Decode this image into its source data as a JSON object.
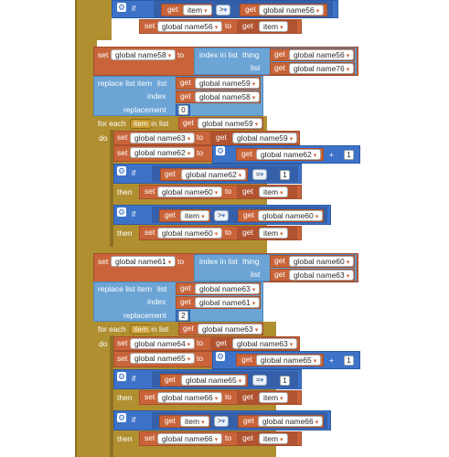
{
  "kw": {
    "if": "if",
    "then": "then",
    "set": "set",
    "to": "to",
    "get": "get",
    "index_in_list": "index in list",
    "thing": "thing",
    "list": "list",
    "replace_list_item": "replace list item",
    "index": "index",
    "replacement": "replacement",
    "for_each": "for each",
    "in_list": "in list",
    "do": "do",
    "item": "item",
    "plus": "+"
  },
  "ops": {
    "gt": ">",
    "eq": "="
  },
  "vars": {
    "n56": "global name56",
    "n58": "global name58",
    "n59": "global name59",
    "n60": "global name60",
    "n61": "global name61",
    "n62": "global name62",
    "n63": "global name63",
    "n64": "global name64",
    "n65": "global name65",
    "n66": "global name66",
    "n76": "global name76",
    "item": "item"
  },
  "nums": {
    "zero": "0",
    "one": "1",
    "two": "2"
  },
  "icons": {
    "gear": "gear-icon",
    "dropdown": "chevron-down-icon"
  },
  "colors": {
    "control": "#b08f30",
    "variable": "#c9643a",
    "list": "#6ba4d5",
    "math_logic": "#3d72c9"
  }
}
